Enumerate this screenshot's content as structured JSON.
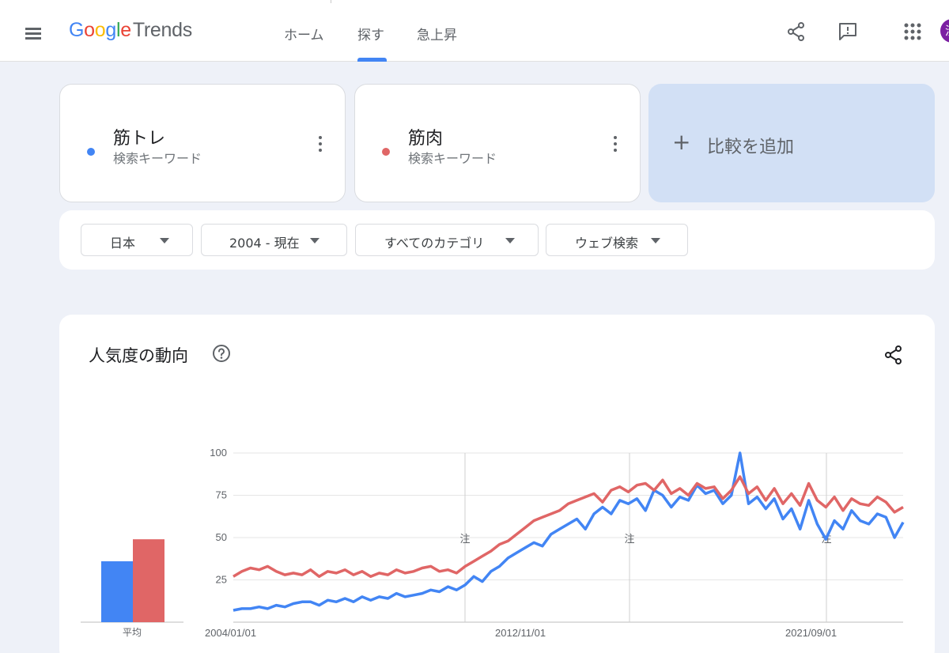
{
  "header": {
    "logo": {
      "g1": "G",
      "g2": "o",
      "g3": "o",
      "g4": "g",
      "g5": "l",
      "g6": "e",
      "trends": "Trends"
    },
    "nav": [
      "ホーム",
      "探す",
      "急上昇"
    ],
    "active_nav": "探す",
    "avatar_initial": "渋"
  },
  "terms": [
    {
      "name": "筋トレ",
      "sub": "検索キーワード",
      "color": "#4285f4"
    },
    {
      "name": "筋肉",
      "sub": "検索キーワード",
      "color": "#e06666"
    }
  ],
  "add_compare": {
    "plus": "+",
    "label": "比較を追加"
  },
  "filters": {
    "region": "日本",
    "time": "2004 - 現在",
    "category": "すべてのカテゴリ",
    "search_type": "ウェブ検索"
  },
  "trend": {
    "title": "人気度の動向",
    "average_label": "平均"
  },
  "chart_data": {
    "type": "line",
    "ylim": [
      0,
      100
    ],
    "yticks": [
      25,
      50,
      75,
      100
    ],
    "x_labels": [
      "2004/01/01",
      "2012/11/01",
      "2021/09/01"
    ],
    "annotations": [
      "注",
      "注",
      "注"
    ],
    "averages": [
      {
        "name": "筋トレ",
        "value": 36,
        "color": "#4285f4"
      },
      {
        "name": "筋肉",
        "value": 49,
        "color": "#e06666"
      }
    ],
    "series": [
      {
        "name": "筋トレ",
        "color": "#4285f4",
        "values": [
          7,
          8,
          8,
          9,
          8,
          10,
          9,
          11,
          12,
          12,
          10,
          13,
          12,
          14,
          12,
          15,
          13,
          15,
          14,
          17,
          15,
          16,
          17,
          19,
          18,
          21,
          19,
          22,
          27,
          24,
          30,
          33,
          38,
          41,
          44,
          47,
          45,
          52,
          55,
          58,
          61,
          55,
          64,
          68,
          64,
          72,
          70,
          73,
          66,
          78,
          75,
          68,
          74,
          72,
          81,
          76,
          78,
          70,
          75,
          100,
          70,
          74,
          67,
          73,
          61,
          67,
          55,
          72,
          58,
          49,
          60,
          55,
          66,
          60,
          58,
          64,
          62,
          50,
          59
        ]
      },
      {
        "name": "筋肉",
        "color": "#e06666",
        "values": [
          27,
          30,
          32,
          31,
          33,
          30,
          28,
          29,
          28,
          31,
          27,
          30,
          29,
          31,
          28,
          30,
          27,
          29,
          28,
          31,
          29,
          30,
          32,
          33,
          30,
          31,
          29,
          33,
          36,
          39,
          42,
          46,
          48,
          52,
          56,
          60,
          62,
          64,
          66,
          70,
          72,
          74,
          76,
          71,
          78,
          80,
          77,
          81,
          82,
          78,
          84,
          76,
          79,
          75,
          82,
          79,
          80,
          73,
          78,
          86,
          76,
          80,
          72,
          79,
          70,
          76,
          69,
          82,
          72,
          68,
          74,
          66,
          73,
          70,
          69,
          74,
          71,
          65,
          68
        ]
      }
    ]
  }
}
